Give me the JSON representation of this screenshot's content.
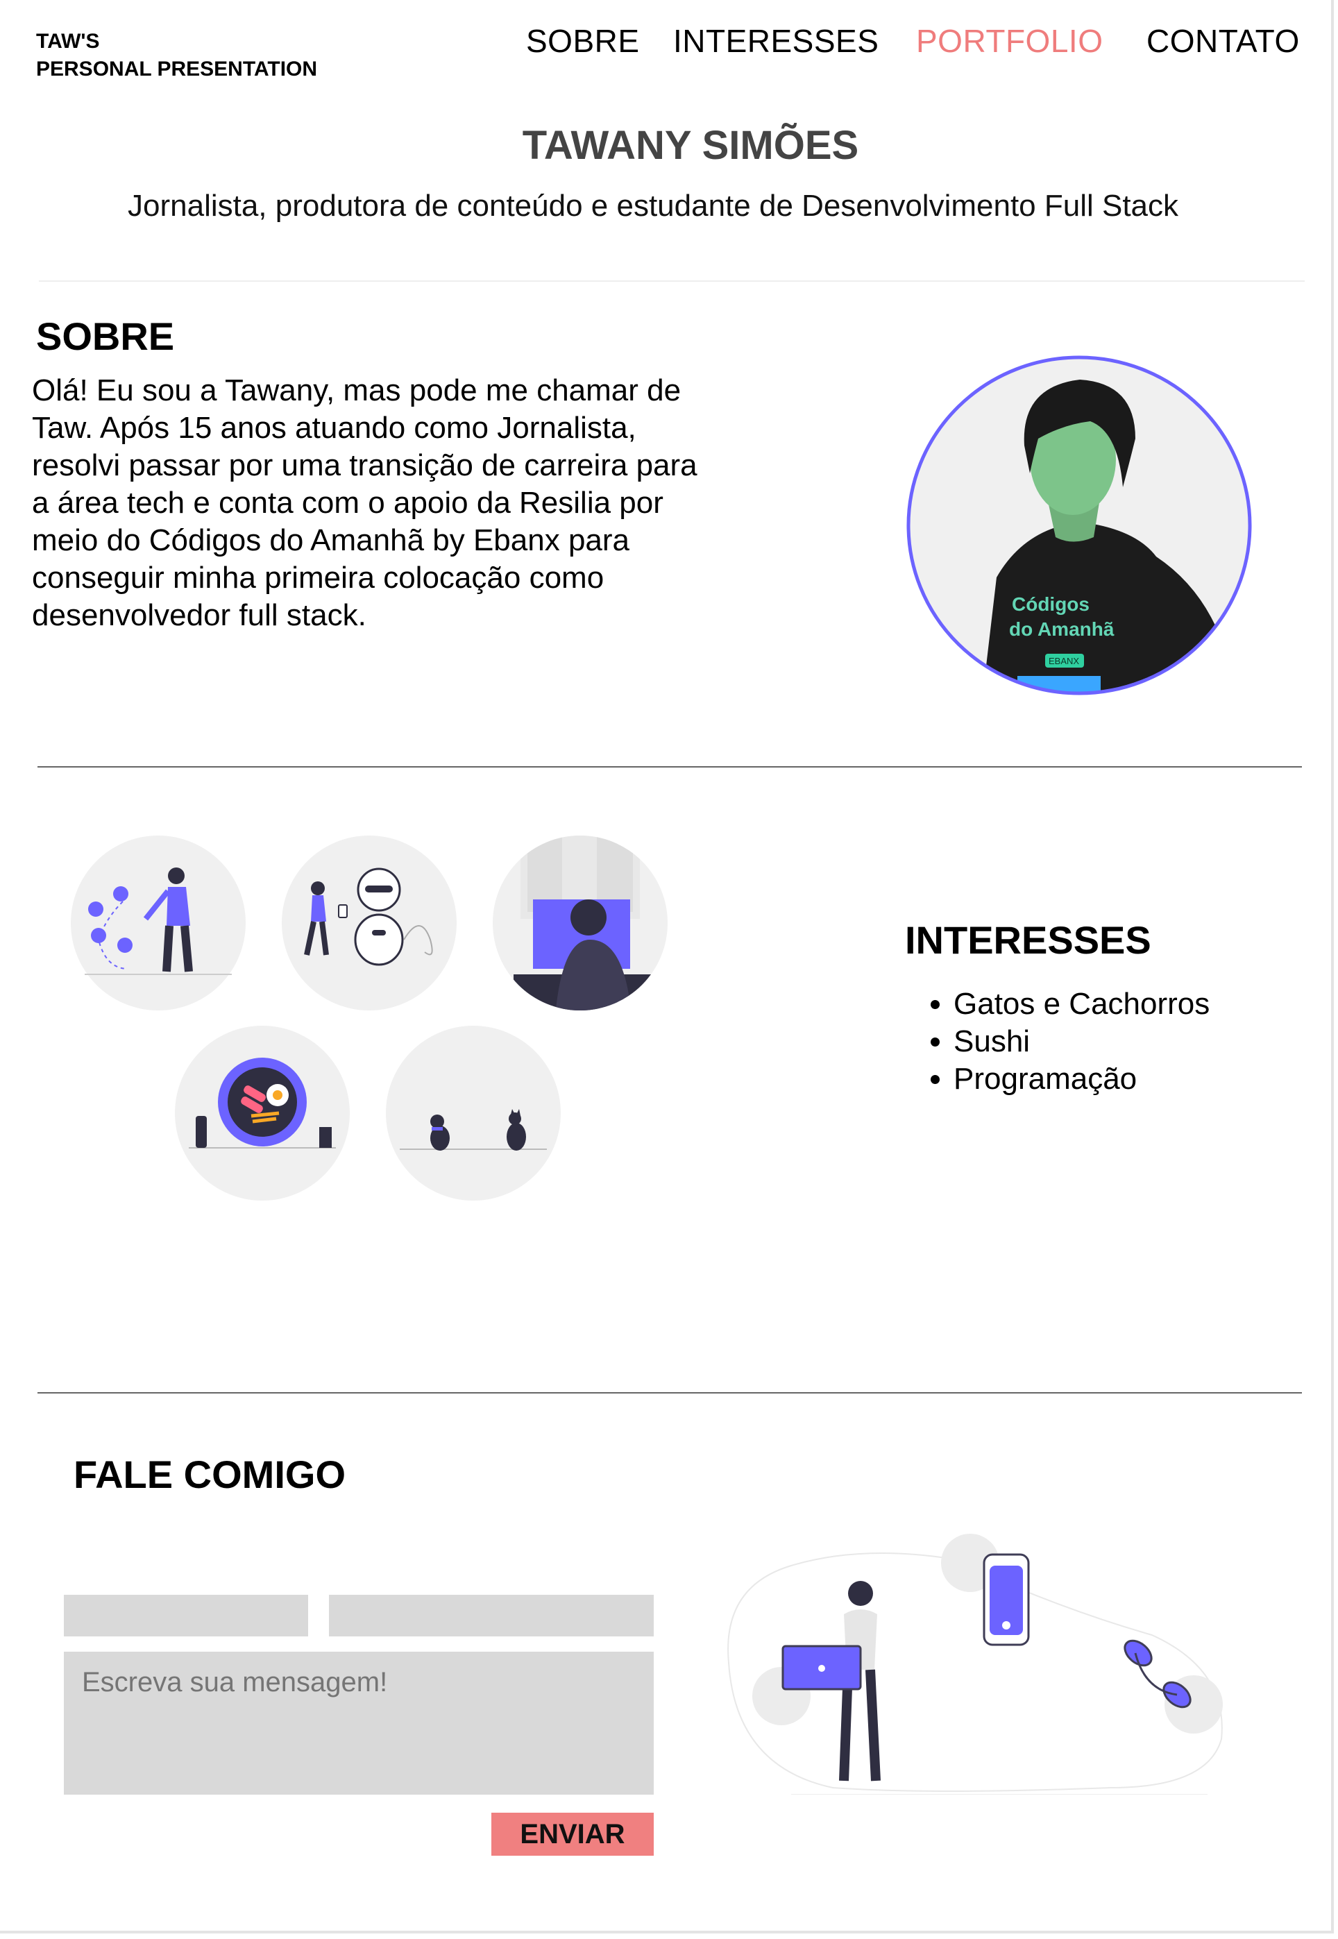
{
  "header": {
    "logo_line1": "TAW'S",
    "logo_line2": "PERSONAL PRESENTATION",
    "nav": [
      {
        "label": "SOBRE"
      },
      {
        "label": "INTERESSES"
      },
      {
        "label": "PORTFOLIO"
      },
      {
        "label": "CONTATO"
      }
    ],
    "active_nav": "PORTFOLIO"
  },
  "hero": {
    "name": "TAWANY SIMÕES",
    "subtitle": "Jornalista, produtora de conteúdo e estudante de Desenvolvimento Full Stack"
  },
  "about": {
    "title": "SOBRE",
    "text": "Olá! Eu sou a Tawany, mas pode me chamar de Taw. Após 15 anos atuando como Jornalista, resolvi passar por uma transição de carreira para a área tech e conta com o apoio da Resilia por meio do Códigos do Amanhã by Ebanx para conseguir minha primeira colocação como desenvolvedor full stack.",
    "shirt_text_line1": "Códigos",
    "shirt_text_line2": "do Amanhã",
    "shirt_badge": "EBANX"
  },
  "interests": {
    "title": "INTERESSES",
    "items": [
      "Gatos e Cachorros",
      "Sushi",
      "Programação"
    ],
    "illustrations": [
      "social-media-illustration",
      "robot-illustration",
      "programmer-illustration",
      "food-illustration",
      "pets-illustration"
    ]
  },
  "contact": {
    "title": "FALE COMIGO",
    "message_placeholder": "Escreva sua mensagem!",
    "send_label": "ENVIAR"
  },
  "colors": {
    "accent": "#6c63ff",
    "nav_active": "#ef7c7c",
    "button": "#f08080",
    "field": "#d9d9d9",
    "circle_bg": "#f0f0f0"
  }
}
